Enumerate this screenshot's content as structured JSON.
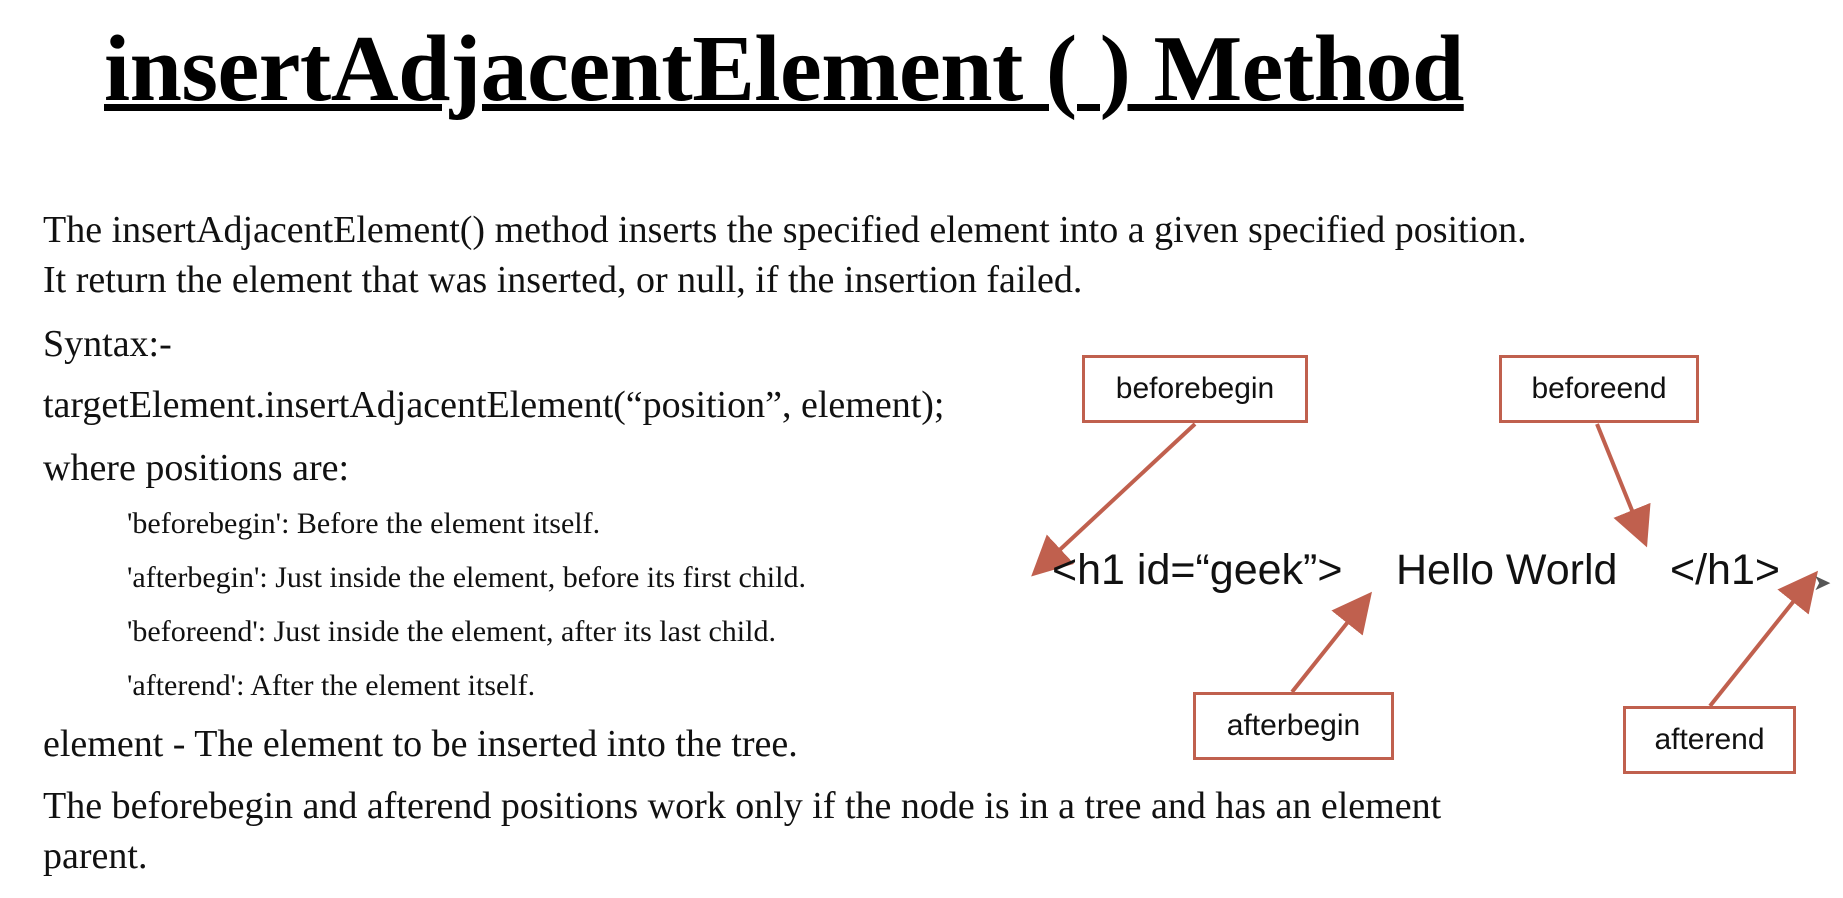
{
  "title": "insertAdjacentElement ( ) Method",
  "description": {
    "line1": "The insertAdjacentElement() method inserts the specified element into a given specified position.",
    "line2": "It return the element that was inserted, or null, if the insertion failed."
  },
  "syntax": {
    "label": "Syntax:-",
    "code": "targetElement.insertAdjacentElement(“position”, element);",
    "where": "where positions are:"
  },
  "positions": [
    "'beforebegin': Before the element itself.",
    "'afterbegin': Just inside the element, before its first child.",
    "'beforeend': Just inside the element, after its last child.",
    "'afterend': After the element itself."
  ],
  "element_desc": "element - The element to be inserted into the tree.",
  "note": {
    "line1": "The beforebegin and afterend positions work only if the node is in a tree and has an element",
    "line2": "parent."
  },
  "diagram": {
    "labels": {
      "beforebegin": "beforebegin",
      "beforeend": "beforeend",
      "afterbegin": "afterbegin",
      "afterend": "afterend"
    },
    "code": {
      "open_tag": "<h1 id=“geek”>",
      "content": "Hello World",
      "close_tag": "</h1>"
    },
    "arrow_color": "#c0604e"
  },
  "icons": {
    "cursor": "mouse-pointer-icon"
  }
}
